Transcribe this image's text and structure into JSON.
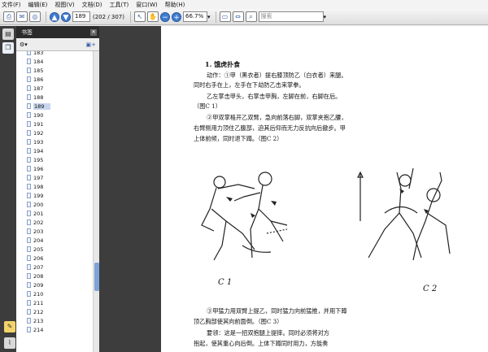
{
  "menu": [
    "文件(F)",
    "编辑(E)",
    "视图(V)",
    "文档(D)",
    "工具(T)",
    "窗口(W)",
    "帮助(H)"
  ],
  "toolbar": {
    "page_current": "189",
    "page_count": "(202 / 307)",
    "zoom": "66.7%",
    "search_placeholder": "搜索"
  },
  "panel": {
    "title": "书签",
    "bookmarks": [
      "183",
      "184",
      "185",
      "186",
      "187",
      "188",
      "189",
      "190",
      "191",
      "192",
      "193",
      "194",
      "195",
      "196",
      "197",
      "198",
      "199",
      "200",
      "201",
      "202",
      "203",
      "204",
      "205",
      "206",
      "207",
      "208",
      "209",
      "210",
      "211",
      "212",
      "213",
      "214"
    ],
    "selected_index": 6
  },
  "document": {
    "heading": "1. 饿虎扑食",
    "lines": [
      "动作：①甲（黑衣者）提右膝顶防乙（白衣者）来腿。",
      "同时右手在上，左手在下劫防乙击来掌拳。",
      "乙左掌击甲头，右掌击甲胸，左脚在前，右脚在后。",
      "（图C 1）",
      "②甲双掌格开乙双臂，急向前落右脚，双掌夹抱乙腰，",
      "右臂侧用力顶住乙腹部，迫其后仰而无力反抗向后撤步。甲",
      "上体前倾，同时退下蹲。（图C 2）"
    ],
    "caption_1": "C 1",
    "caption_2": "C 2",
    "bottom_lines": [
      "③甲猛力用双臂上提乙，同时猛力向前猛推，并用下蹲",
      "顶乙胸部使其向前面倒。（图C 3）",
      "要领：这是一招双抱腿上提摔。同时必须将对方",
      "抱起，使其重心向后倒。上体下蹲同时用力，方能奏"
    ]
  }
}
